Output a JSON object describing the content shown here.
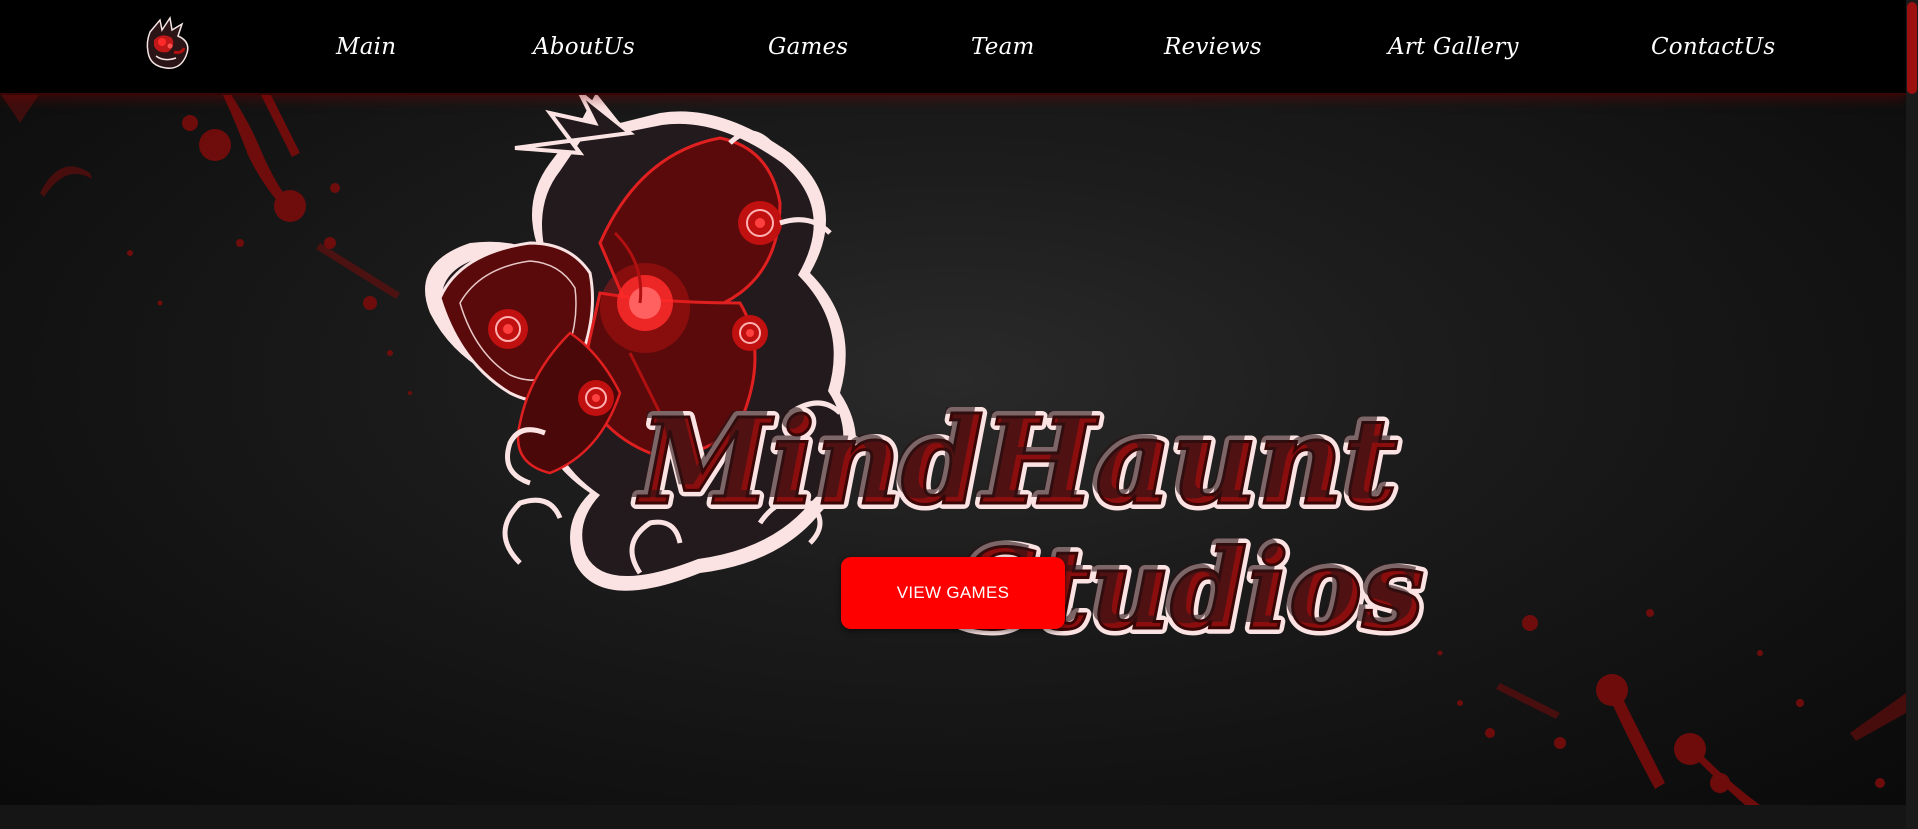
{
  "nav": {
    "items": [
      {
        "label": "Main"
      },
      {
        "label": "AboutUs"
      },
      {
        "label": "Games"
      },
      {
        "label": "Team"
      },
      {
        "label": "Reviews"
      },
      {
        "label": "Art Gallery"
      },
      {
        "label": "ContactUs"
      }
    ],
    "logo_icon": "mindhaunt-avatar-icon"
  },
  "hero": {
    "logo_text_line1": "MindHaunt",
    "logo_text_line2": "Studios",
    "cta_label": "VIEW GAMES"
  },
  "colors": {
    "accent": "#ff0000",
    "dark_red": "#8b0e0e",
    "background": "#111111",
    "nav_background": "#000000"
  }
}
